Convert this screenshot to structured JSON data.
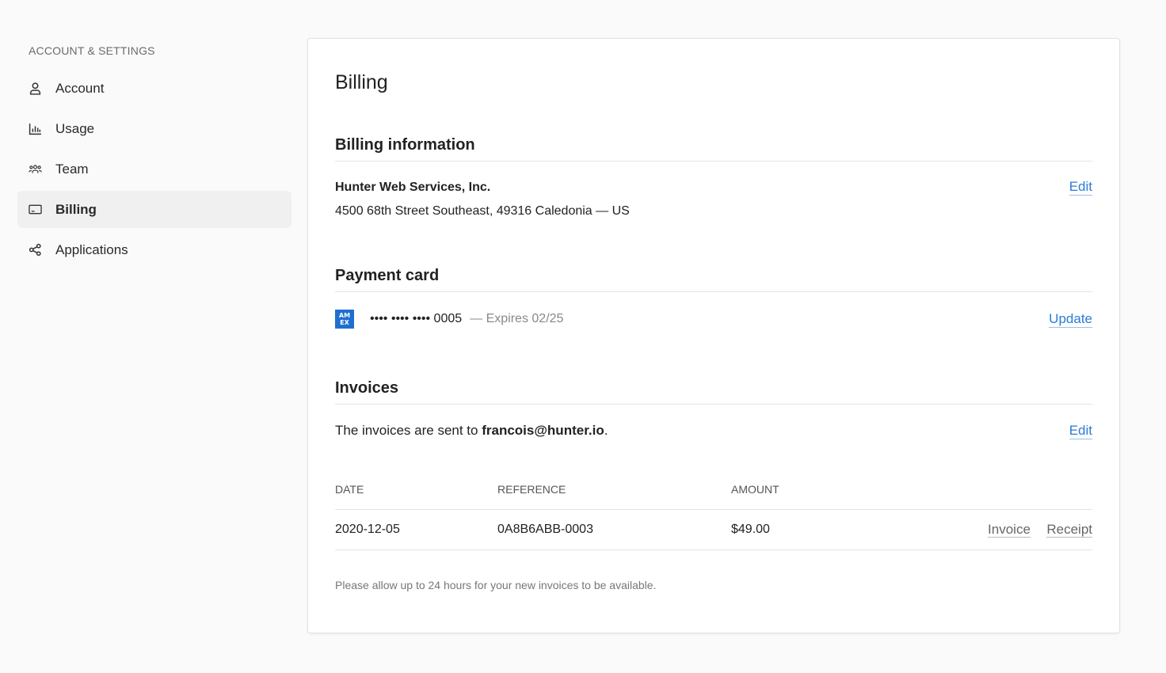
{
  "sidebar": {
    "heading": "ACCOUNT & SETTINGS",
    "items": [
      {
        "label": "Account",
        "icon": "user-icon"
      },
      {
        "label": "Usage",
        "icon": "bar-chart-icon"
      },
      {
        "label": "Team",
        "icon": "team-icon"
      },
      {
        "label": "Billing",
        "icon": "card-icon",
        "active": true
      },
      {
        "label": "Applications",
        "icon": "share-icon"
      }
    ]
  },
  "main": {
    "title": "Billing",
    "billing_info": {
      "heading": "Billing information",
      "company": "Hunter Web Services, Inc.",
      "address": "4500 68th Street Southeast, 49316 Caledonia — US",
      "edit_label": "Edit"
    },
    "payment_card": {
      "heading": "Payment card",
      "brand_text": "AM EX",
      "number": "•••• •••• •••• 0005",
      "expiry": "— Expires 02/25",
      "update_label": "Update"
    },
    "invoices": {
      "heading": "Invoices",
      "sent_to_prefix": "The invoices are sent to ",
      "email": "francois@hunter.io",
      "sent_to_suffix": ".",
      "edit_label": "Edit",
      "columns": [
        "DATE",
        "REFERENCE",
        "AMOUNT"
      ],
      "rows": [
        {
          "date": "2020-12-05",
          "reference": "0A8B6ABB-0003",
          "amount": "$49.00",
          "invoice_label": "Invoice",
          "receipt_label": "Receipt"
        }
      ],
      "note": "Please allow up to 24 hours for your new invoices to be available."
    }
  },
  "colors": {
    "link": "#2b7bd6",
    "active_bg": "#f0f0f0",
    "amex": "#1e6fd0"
  }
}
